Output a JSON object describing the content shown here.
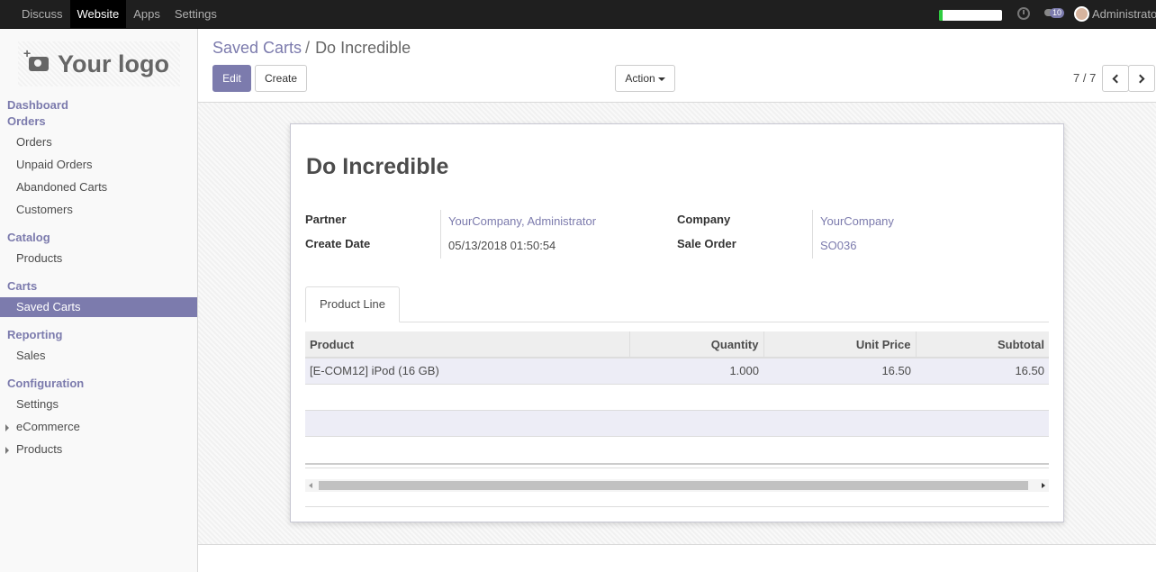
{
  "topbar": {
    "menu": [
      "Discuss",
      "Website",
      "Apps",
      "Settings"
    ],
    "active_menu": "Website",
    "user_name": "Administrator",
    "message_count": "10",
    "progress_fraction": 0.05
  },
  "sidebar": {
    "logo_text": "Your logo",
    "sections": {
      "dashboard": "Dashboard",
      "orders": "Orders",
      "catalog": "Catalog",
      "carts": "Carts",
      "reporting": "Reporting",
      "configuration": "Configuration"
    },
    "items": {
      "orders": "Orders",
      "unpaid_orders": "Unpaid Orders",
      "abandoned_carts": "Abandoned Carts",
      "customers": "Customers",
      "products": "Products",
      "saved_carts": "Saved Carts",
      "sales": "Sales",
      "settings": "Settings",
      "ecommerce": "eCommerce",
      "config_products": "Products"
    }
  },
  "breadcrumb": {
    "parent": "Saved Carts",
    "separator": "/",
    "current": "Do Incredible"
  },
  "buttons": {
    "edit": "Edit",
    "create": "Create",
    "action": "Action"
  },
  "pager": {
    "text": "7 / 7"
  },
  "record": {
    "title": "Do Incredible",
    "labels": {
      "partner": "Partner",
      "create_date": "Create Date",
      "company": "Company",
      "sale_order": "Sale Order"
    },
    "values": {
      "partner": "YourCompany, Administrator",
      "create_date": "05/13/2018 01:50:54",
      "company": "YourCompany",
      "sale_order": "SO036"
    }
  },
  "tabs": {
    "product_line": "Product Line"
  },
  "table": {
    "headers": {
      "product": "Product",
      "quantity": "Quantity",
      "unit_price": "Unit Price",
      "subtotal": "Subtotal"
    },
    "rows": [
      {
        "product": "[E-COM12] iPod (16 GB)",
        "quantity": "1.000",
        "unit_price": "16.50",
        "subtotal": "16.50"
      }
    ]
  },
  "colors": {
    "brand": "#7c7bad",
    "navbar": "#1f1f1f"
  }
}
